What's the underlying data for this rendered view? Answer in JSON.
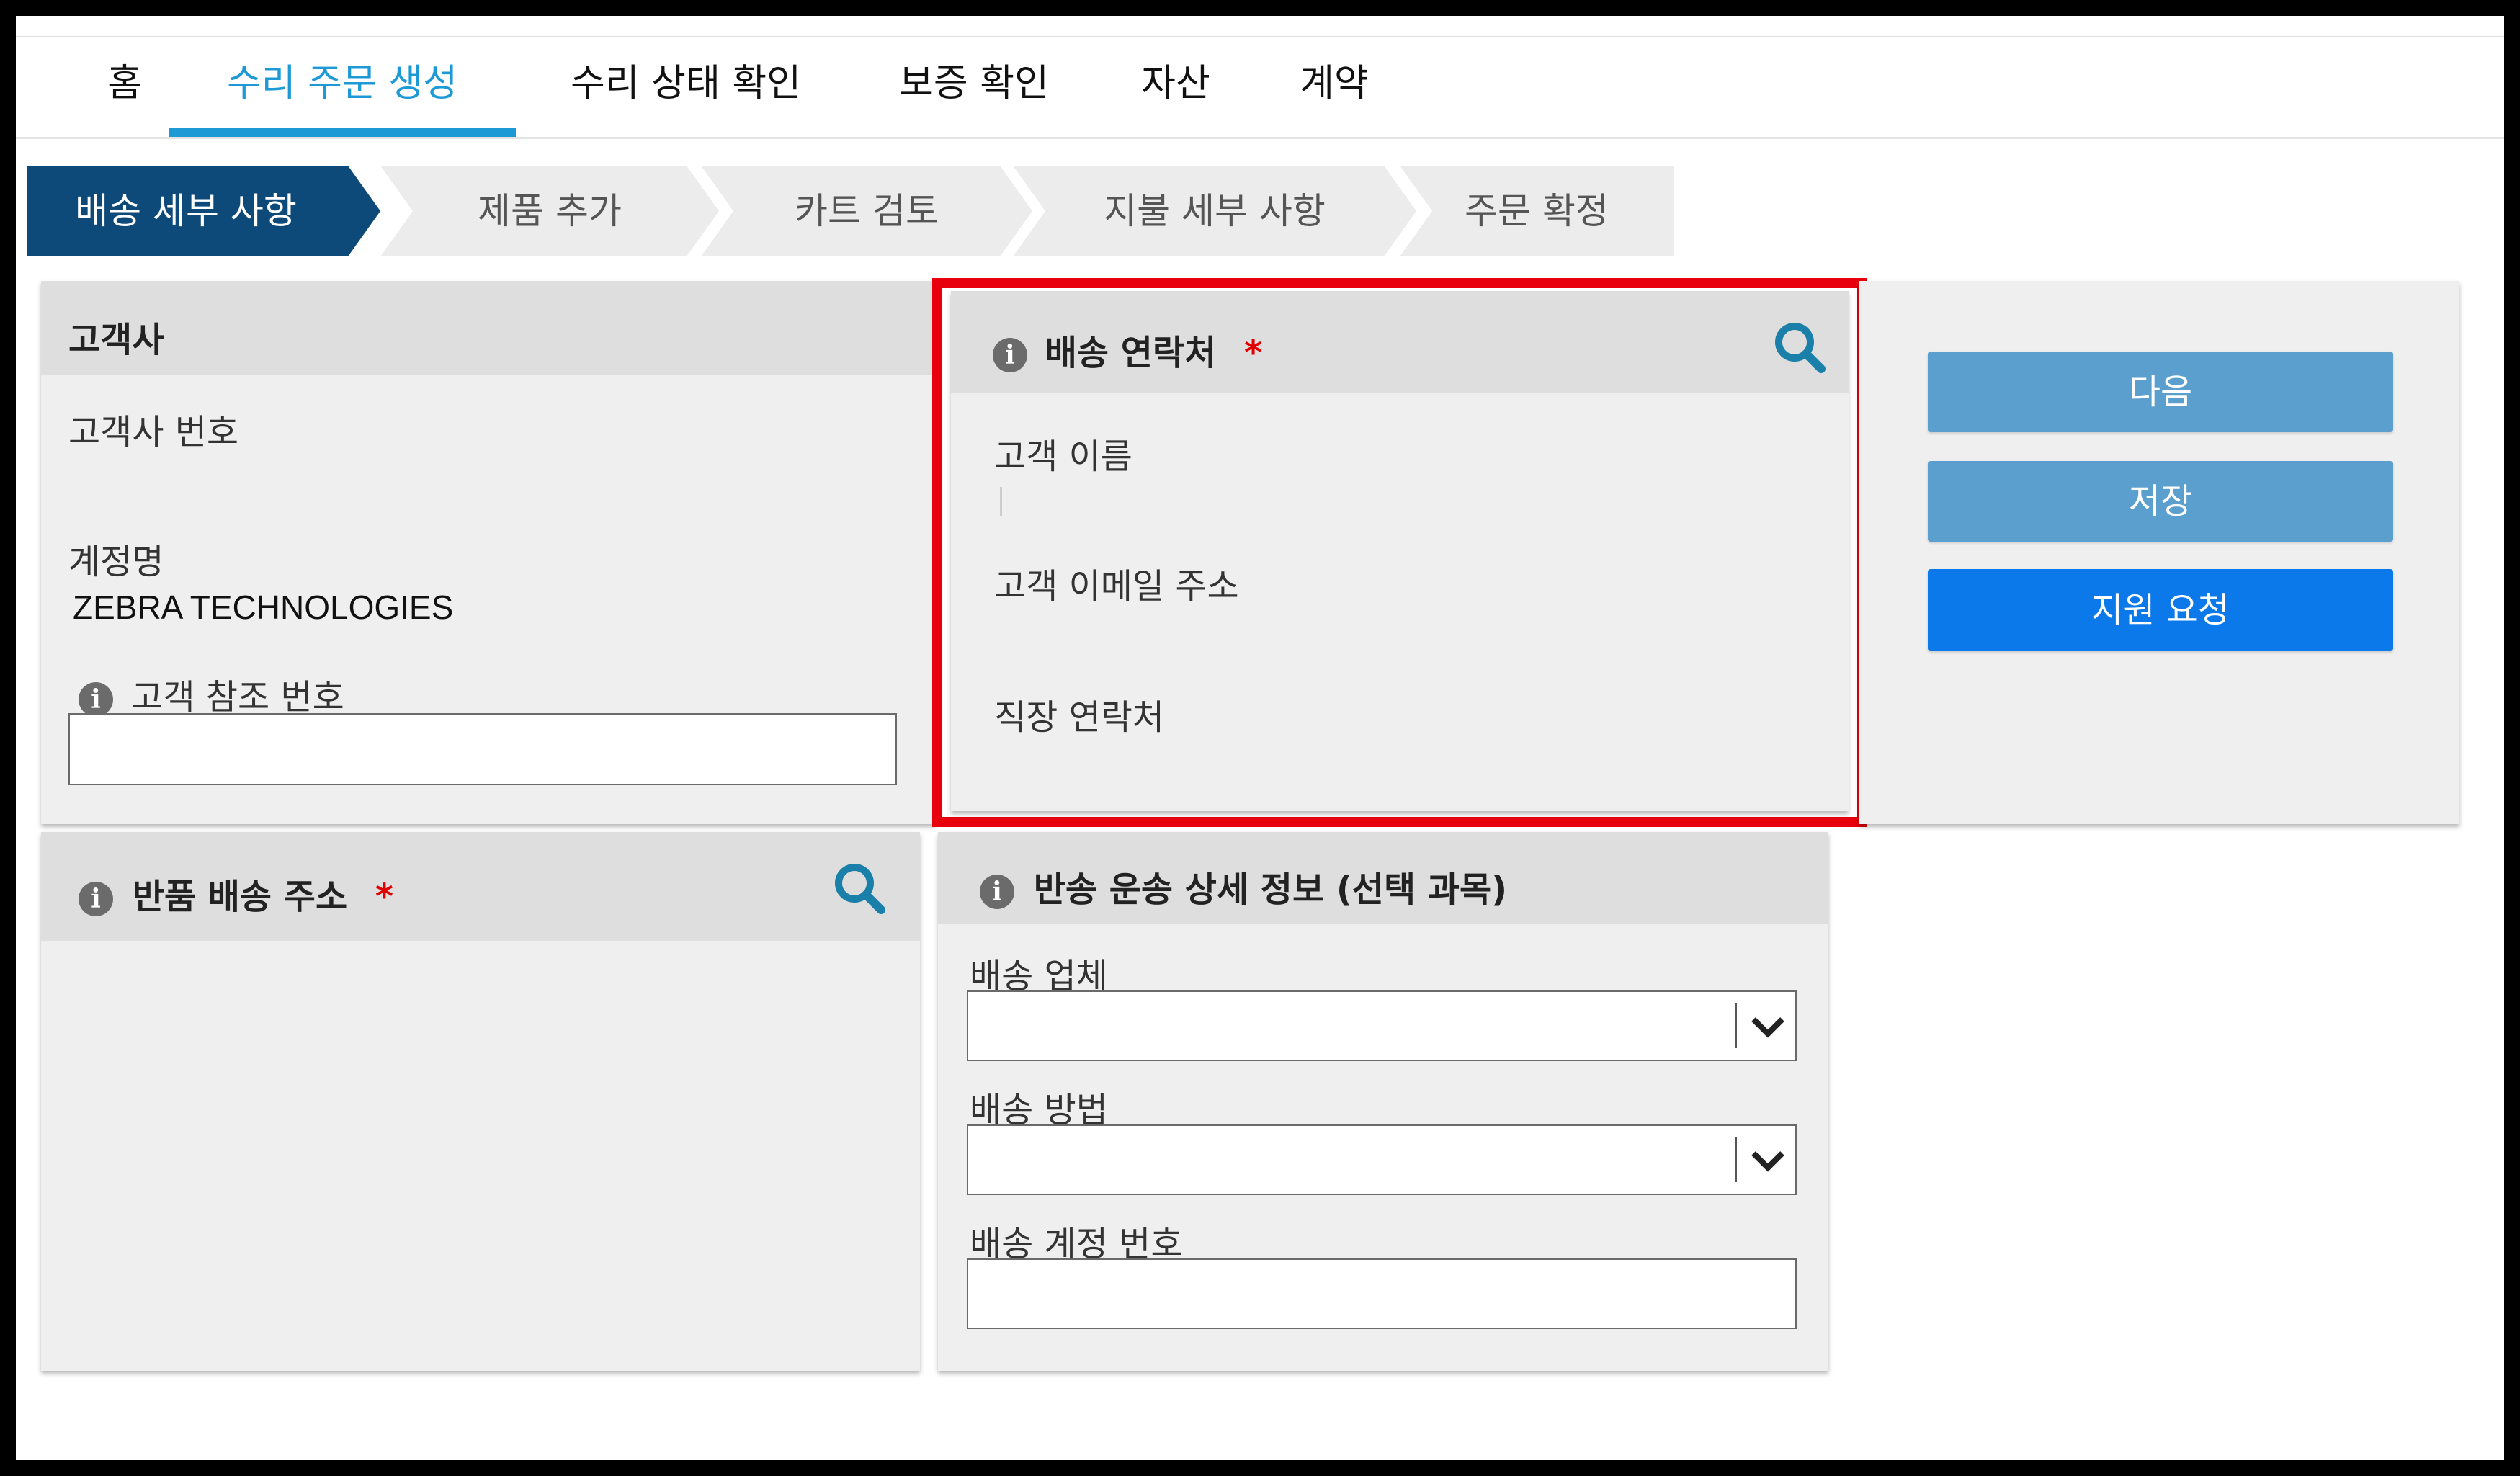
{
  "nav": {
    "items": [
      {
        "label": "홈"
      },
      {
        "label": "수리 주문 생성"
      },
      {
        "label": "수리 상태 확인"
      },
      {
        "label": "보증 확인"
      },
      {
        "label": "자산"
      },
      {
        "label": "계약"
      }
    ],
    "active_index": 1
  },
  "steps": {
    "items": [
      {
        "label": "배송 세부 사항"
      },
      {
        "label": "제품 추가"
      },
      {
        "label": "카트 검토"
      },
      {
        "label": "지불 세부 사항"
      },
      {
        "label": "주문 확정"
      }
    ],
    "active_index": 0
  },
  "customer_panel": {
    "title": "고객사",
    "customer_number_label": "고객사 번호",
    "customer_number_value": "",
    "account_name_label": "계정명",
    "account_name_value": "ZEBRA TECHNOLOGIES",
    "customer_ref_label": "고객 참조 번호",
    "customer_ref_value": ""
  },
  "shipping_contact_panel": {
    "title": "배송 연락처",
    "required_mark": "*",
    "customer_name_label": "고객 이름",
    "customer_email_label": "고객 이메일 주소",
    "work_contact_label": "직장 연락처"
  },
  "actions": {
    "next_label": "다음",
    "save_label": "저장",
    "support_label": "지원 요청"
  },
  "return_address_panel": {
    "title": "반품 배송 주소",
    "required_mark": "*"
  },
  "return_shipping_panel": {
    "title": "반송 운송 상세 정보 (선택 과목)",
    "carrier_label": "배송 업체",
    "carrier_value": "",
    "method_label": "배송 방법",
    "method_value": "",
    "account_number_label": "배송 계정 번호",
    "account_number_value": ""
  },
  "colors": {
    "accent": "#1d9ad6",
    "step_active": "#0d4a7a",
    "highlight": "#e8000c",
    "button_light": "#5a9fcd",
    "button_primary": "#0b79ea"
  }
}
